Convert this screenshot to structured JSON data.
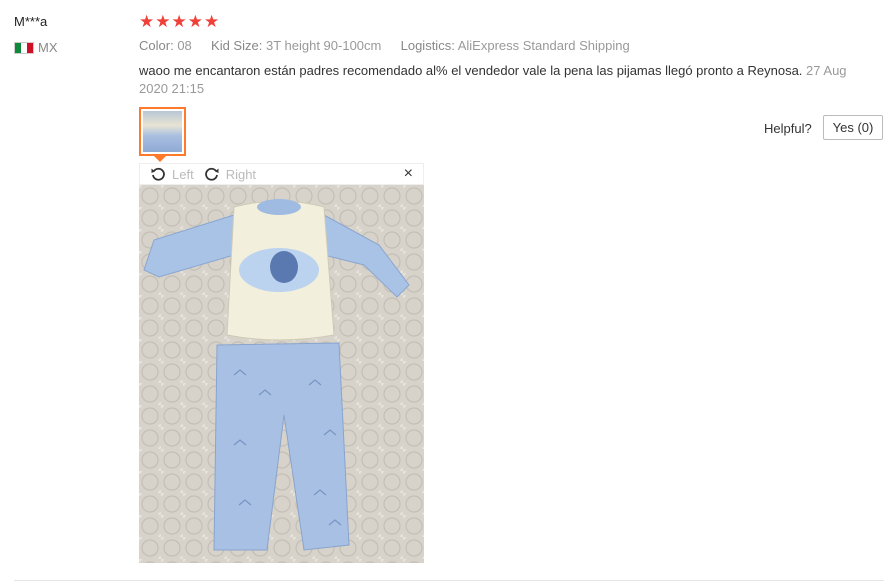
{
  "review": {
    "username": "M***a",
    "country_code": "MX",
    "flag_colors": [
      "#0f8a3c",
      "#ffffff",
      "#ce1126"
    ],
    "rating": 5,
    "star_color": "#f0403a",
    "properties": [
      {
        "key": "Color:",
        "value": "08"
      },
      {
        "key": "Kid Size:",
        "value": "3T height 90-100cm"
      },
      {
        "key": "Logistics:",
        "value": "AliExpress Standard Shipping"
      }
    ],
    "text": "waoo me encantaron están padres recomendado al% el vendedor vale la pena las pijamas llegó pronto a Reynosa.",
    "date": "27 Aug 2020 21:15",
    "helpful_label": "Helpful?",
    "yes_label": "Yes (0)"
  },
  "viewer": {
    "rotate_left_label": "Left",
    "rotate_right_label": "Right",
    "close_icon": "×",
    "accent_color": "#ff7a2b"
  }
}
